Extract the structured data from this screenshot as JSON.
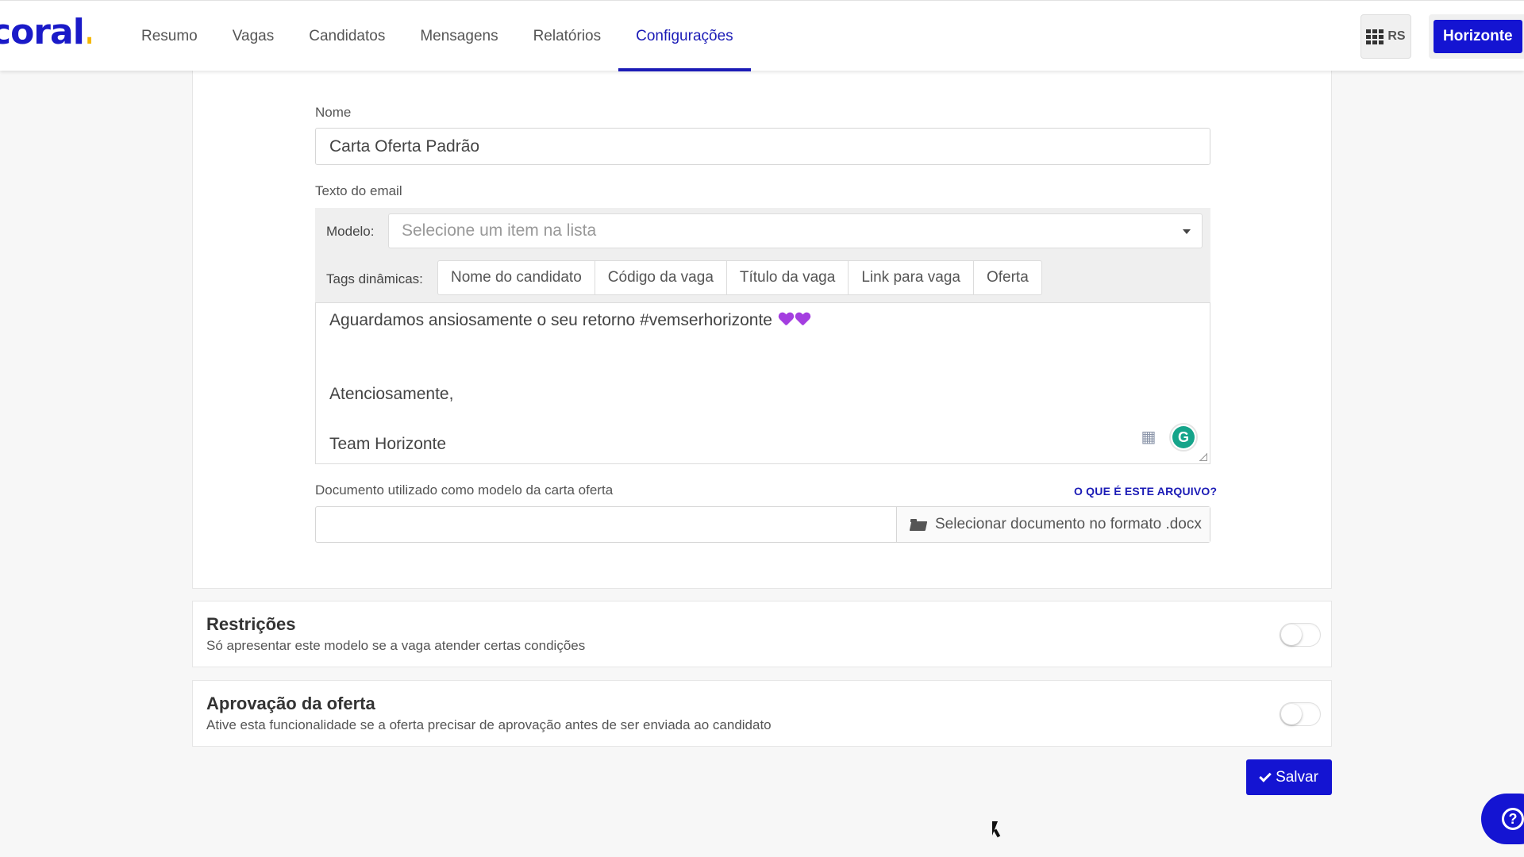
{
  "app": {
    "logo_text": "coral",
    "logo_dot": "."
  },
  "nav": {
    "tabs": [
      {
        "label": "Resumo",
        "active": false
      },
      {
        "label": "Vagas",
        "active": false
      },
      {
        "label": "Candidatos",
        "active": false
      },
      {
        "label": "Mensagens",
        "active": false
      },
      {
        "label": "Relatórios",
        "active": false
      },
      {
        "label": "Configurações",
        "active": true
      }
    ],
    "apps_initials": "RS",
    "company_button": "Horizonte"
  },
  "form": {
    "name_label": "Nome",
    "name_value": "Carta Oferta Padrão",
    "email_text_label": "Texto do email",
    "model_label": "Modelo:",
    "model_placeholder": "Selecione um item na lista",
    "tags_label": "Tags dinâmicas:",
    "tags": [
      "Nome do candidato",
      "Código da vaga",
      "Título da vaga",
      "Link para vaga",
      "Oferta"
    ],
    "editor_lines": [
      "Aguardamos ansiosamente o seu retorno #vemserhorizonte",
      "Atenciosamente,",
      "Team Horizonte"
    ],
    "document_label": "Documento utilizado como modelo da carta oferta",
    "document_help_link": "O QUE É ESTE ARQUIVO?",
    "document_select_button": "Selecionar documento no formato .docx"
  },
  "sections": {
    "restrictions": {
      "title": "Restrições",
      "description": "Só apresentar este modelo se a vaga atender certas condições",
      "enabled": false
    },
    "approval": {
      "title": "Aprovação da oferta",
      "description": "Ative esta funcionalidade se a oferta precisar de aprovação antes de ser enviada ao candidato",
      "enabled": false
    }
  },
  "actions": {
    "save_label": "Salvar"
  },
  "colors": {
    "brand": "#1414d2",
    "brand_accent": "#f5b800",
    "heart": "#a43ee0",
    "grammarly": "#15a48a"
  }
}
